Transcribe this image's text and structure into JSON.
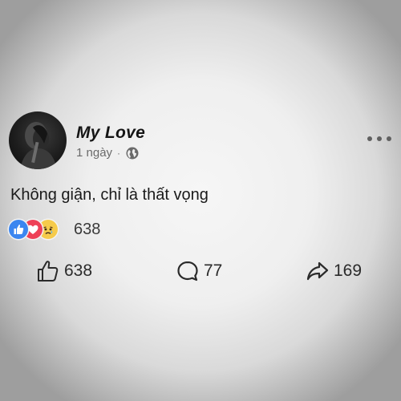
{
  "post": {
    "author": "My Love",
    "time": "1 ngày",
    "separator": "·",
    "privacy_icon": "globe-icon",
    "text": "Không giận, chỉ là thất vọng"
  },
  "reactions": {
    "icons": [
      "like-icon",
      "love-icon",
      "sad-icon"
    ],
    "count": "638",
    "colors": {
      "like": "#3b86f0",
      "love": "#ee4157",
      "sad": "#f6cb4b"
    }
  },
  "actions": {
    "like_count": "638",
    "comment_count": "77",
    "share_count": "169"
  }
}
